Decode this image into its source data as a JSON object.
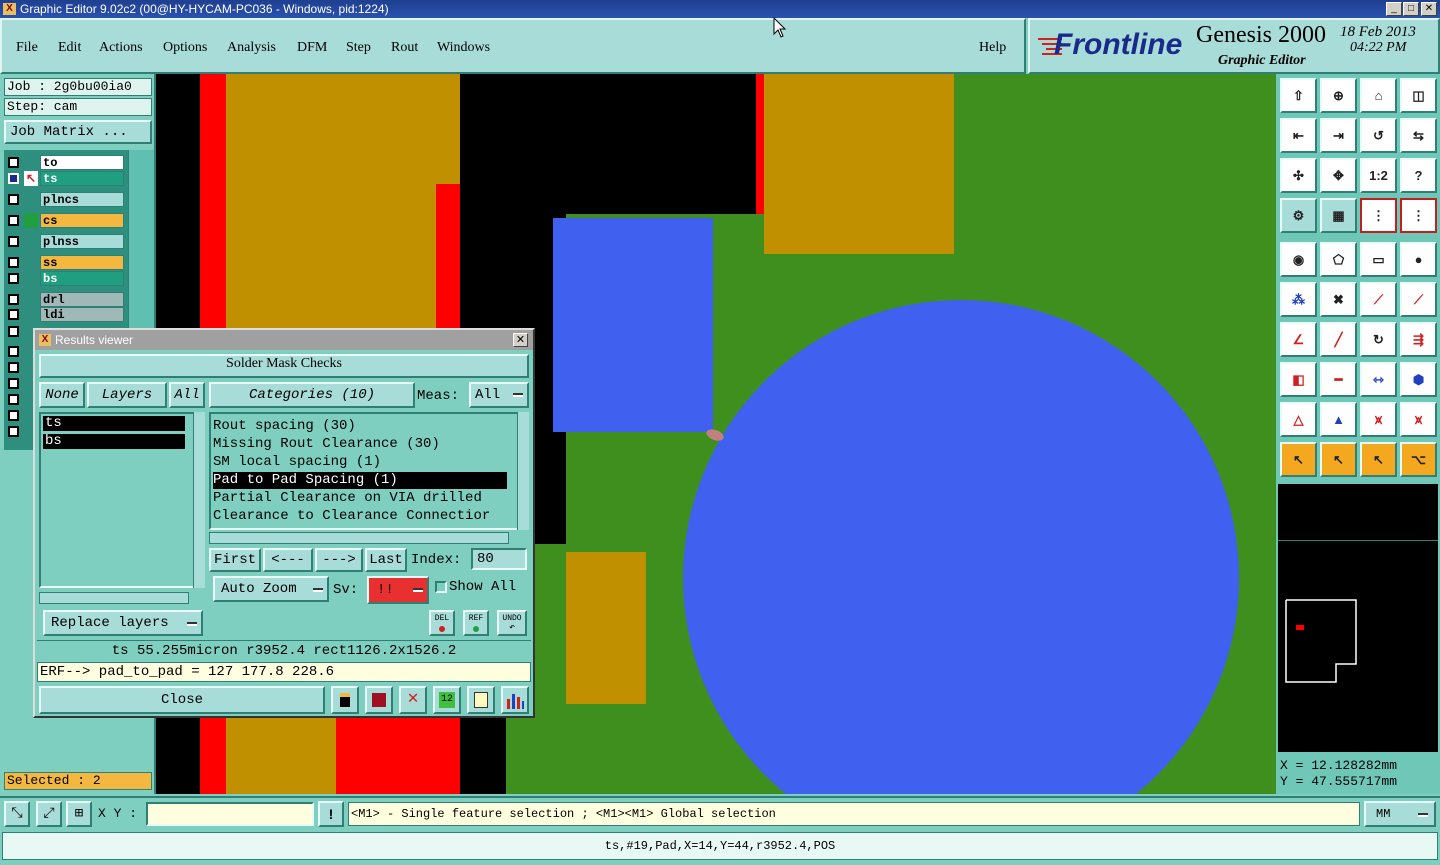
{
  "window": {
    "title": "Graphic Editor 9.02c2 (00@HY-HYCAM-PC036 - Windows, pid:1224)",
    "minimize": "_",
    "maximize": "□",
    "close": "✕"
  },
  "menu": {
    "items": [
      "File",
      "Edit",
      "Actions",
      "Options",
      "Analysis",
      "DFM",
      "Step",
      "Rout",
      "Windows"
    ],
    "help": "Help"
  },
  "brand": {
    "logo": "Frontline",
    "product": "Genesis 2000",
    "subtitle": "Graphic Editor",
    "date": "18 Feb 2013",
    "time": "04:22 PM"
  },
  "left": {
    "job": "Job : 2g0bu00ia0",
    "step": "Step: cam",
    "job_matrix": "Job Matrix ...",
    "layers": [
      {
        "name": "to",
        "color": "#ffffff"
      },
      {
        "name": "ts",
        "color": "#1f9f7f"
      },
      {
        "name": "plncs",
        "color": "#a8dcd8"
      },
      {
        "name": "cs",
        "color": "#f4b840"
      },
      {
        "name": "plnss",
        "color": "#a8dcd8"
      },
      {
        "name": "ss",
        "color": "#f4b840"
      },
      {
        "name": "bs",
        "color": "#1f9f7f"
      },
      {
        "name": "drl",
        "color": "#a0b8b8"
      },
      {
        "name": "ldi",
        "color": "#a0b8b8"
      }
    ],
    "selected": "Selected : 2"
  },
  "results": {
    "title": "Results viewer",
    "heading": "Solder Mask Checks",
    "none_btn": "None",
    "layers_btn": "Layers",
    "all_btn": "All",
    "categories_btn": "Categories (10)",
    "meas_label": "Meas:",
    "meas_value": "All",
    "layers_list": [
      "ts",
      "bs"
    ],
    "categories": [
      "Rout spacing (30)",
      "Missing Rout Clearance (30)",
      "SM local spacing (1)",
      "Pad to Pad Spacing (1)",
      "Partial Clearance on VIA drilled",
      "Clearance to Clearance Connectior"
    ],
    "selected_category_index": 3,
    "first": "First",
    "prev": "<---",
    "next": "--->",
    "last": "Last",
    "index_label": "Index:",
    "index_value": "80",
    "auto_zoom": "Auto Zoom",
    "sv_label": "Sv:",
    "sv_value": "!!",
    "show_all": "Show All",
    "replace_layers": "Replace layers",
    "del": "DEL",
    "ref": "REF",
    "undo": "UNDO",
    "info_line": "ts 55.255micron  r3952.4  rect1126.2x1526.2",
    "erf_line": "ERF--> pad_to_pad = 127 177.8 228.6",
    "close": "Close"
  },
  "coords": {
    "x": "X = 12.128282mm",
    "y": "Y = 47.555717mm"
  },
  "bottom": {
    "xy_label": "X Y :",
    "xy_value": "",
    "hint": "<M1> - Single feature selection ; <M1><M1> Global selection",
    "units": "MM",
    "status": "ts,#19,Pad,X=14,Y=44,r3952.4,POS"
  },
  "toolbar": {
    "one_to_two": "1:2",
    "help_q": "?"
  }
}
